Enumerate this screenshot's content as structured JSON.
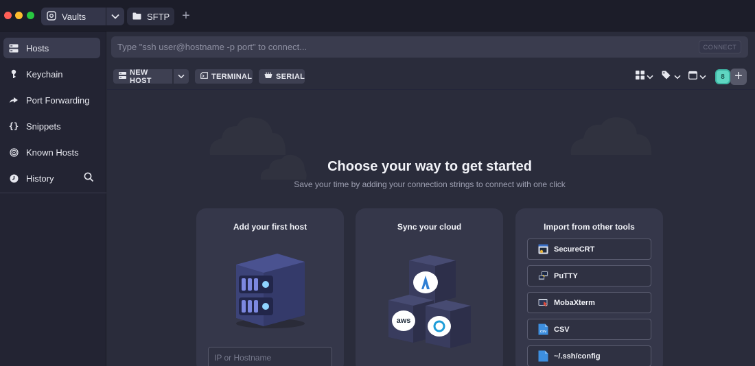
{
  "titlebar": {
    "tabs": [
      {
        "label": "Vaults"
      },
      {
        "label": "SFTP"
      }
    ]
  },
  "sidebar": {
    "items": [
      {
        "label": "Hosts",
        "active": true
      },
      {
        "label": "Keychain"
      },
      {
        "label": "Port Forwarding"
      },
      {
        "label": "Snippets"
      },
      {
        "label": "Known Hosts"
      },
      {
        "label": "History"
      }
    ]
  },
  "command": {
    "placeholder": "Type \"ssh user@hostname -p port\" to connect...",
    "connect_label": "CONNECT"
  },
  "toolbar": {
    "new_host_label": "NEW HOST",
    "terminal_label": "TERMINAL",
    "serial_label": "SERIAL",
    "badge_count": "8"
  },
  "hero": {
    "title": "Choose your way to get started",
    "subtitle": "Save your time by adding your connection strings to connect with one click"
  },
  "cards": [
    {
      "title": "Add your first host",
      "input_placeholder": "IP or Hostname"
    },
    {
      "title": "Sync your cloud",
      "cloud_labels": [
        "aws"
      ]
    },
    {
      "title": "Import from other tools"
    }
  ],
  "import_tools": [
    {
      "label": "SecureCRT"
    },
    {
      "label": "PuTTY"
    },
    {
      "label": "MobaXterm"
    },
    {
      "label": "CSV",
      "icon_text": "CSV"
    },
    {
      "label": "~/.ssh/config"
    }
  ],
  "colors": {
    "accent_teal": "#5fd6c2",
    "sidebar_bg": "#232433",
    "main_bg": "#2a2c3b",
    "card_bg": "#35374a"
  }
}
